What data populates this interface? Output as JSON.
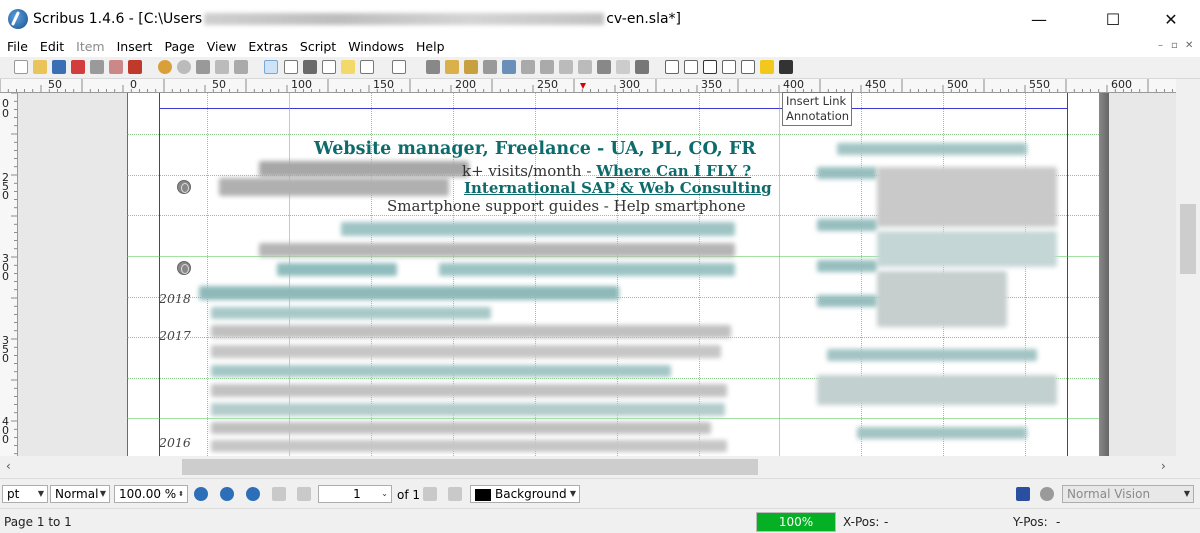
{
  "window": {
    "title_prefix": "Scribus 1.4.6 - [C:\\Users",
    "title_suffix": "cv-en.sla*]",
    "minimize": "—",
    "maximize": "☐",
    "close": "✕"
  },
  "menu": [
    "File",
    "Edit",
    "Item",
    "Insert",
    "Page",
    "View",
    "Extras",
    "Script",
    "Windows",
    "Help"
  ],
  "mdi": {
    "minimize": "–",
    "restore": "▫",
    "close": "✕"
  },
  "tooltip": {
    "line1": "Insert Link",
    "line2": "Annotation"
  },
  "ruler": {
    "h_labels": [
      "50",
      "0",
      "50",
      "100",
      "150",
      "200",
      "250",
      "300",
      "350",
      "400",
      "450",
      "500",
      "550",
      "600"
    ],
    "v_labels": [
      "0",
      "0",
      "2",
      "5",
      "0",
      "3",
      "0",
      "0",
      "3",
      "5",
      "0",
      "4",
      "0",
      "0"
    ]
  },
  "document": {
    "heading": "Website manager, Freelance - UA, PL, CO, FR",
    "line1_prefix": "k+ visits/month - ",
    "line1_link": "Where Can I FLY ?",
    "line2_link": "International SAP & Web Consulting",
    "line3": "Smartphone support guides - Help smartphone",
    "years": [
      "2018",
      "2017",
      "2016"
    ]
  },
  "bottom": {
    "unit": "pt",
    "mode": "Normal",
    "zoom": "100.00 %",
    "page_number": "1",
    "page_of": "of 1",
    "layer": "Background",
    "vision": "Normal Vision"
  },
  "status": {
    "page_info": "Page 1 to 1",
    "progress": "100%",
    "progress_value": 100,
    "xpos_label": "X-Pos:",
    "xpos_value": "-",
    "ypos_label": "Y-Pos:",
    "ypos_value": "-"
  },
  "colors": {
    "heading": "#0e6b6b",
    "link": "#0e6b6b",
    "progress": "#06b025"
  }
}
